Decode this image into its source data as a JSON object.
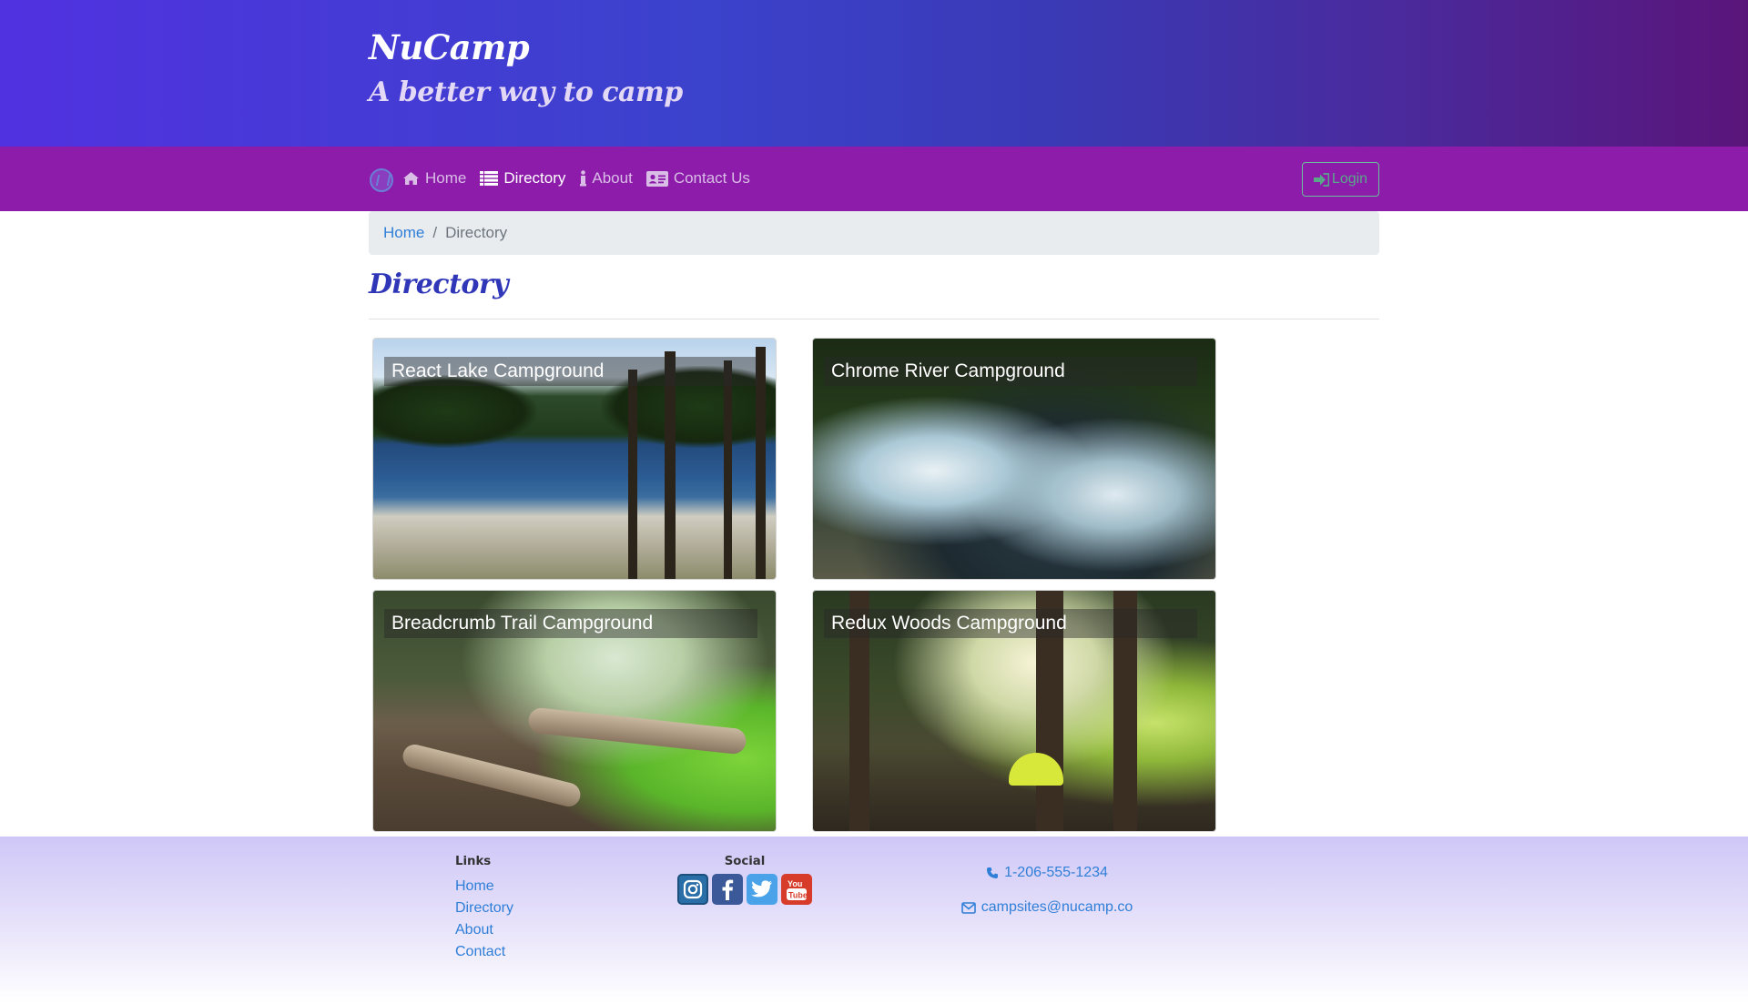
{
  "header": {
    "brand": "NuCamp",
    "tagline": "A better way to camp"
  },
  "navbar": {
    "items": [
      {
        "label": "Home",
        "icon": "home-icon"
      },
      {
        "label": "Directory",
        "icon": "list-icon",
        "active": true
      },
      {
        "label": "About",
        "icon": "info-icon"
      },
      {
        "label": "Contact Us",
        "icon": "address-card-icon"
      }
    ],
    "login_label": "Login"
  },
  "breadcrumb": {
    "home": "Home",
    "separator": "/",
    "current": "Directory"
  },
  "page": {
    "title": "Directory"
  },
  "campsites": [
    {
      "name": "React Lake Campground"
    },
    {
      "name": "Chrome River Campground"
    },
    {
      "name": "Breadcrumb Trail Campground"
    },
    {
      "name": "Redux Woods Campground"
    }
  ],
  "footer": {
    "links_heading": "Links",
    "links": [
      "Home",
      "Directory",
      "About",
      "Contact"
    ],
    "social_heading": "Social",
    "social": [
      "instagram-icon",
      "facebook-icon",
      "twitter-icon",
      "youtube-icon"
    ],
    "phone": "1-206-555-1234",
    "email": "campsites@nucamp.co"
  },
  "colors": {
    "navbar": "#8c1ca9",
    "title": "#2f37b8",
    "link": "#2f7fd8"
  }
}
